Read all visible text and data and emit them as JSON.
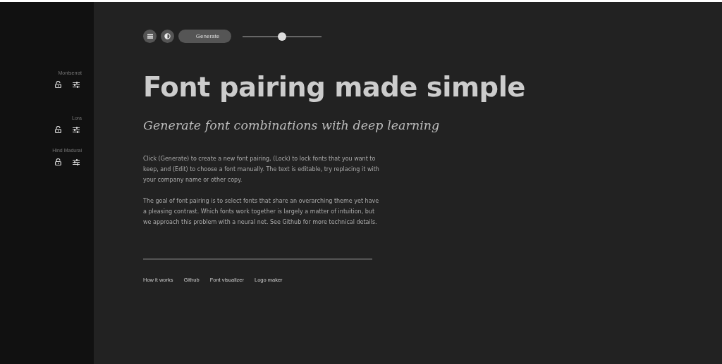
{
  "sidebar": {
    "fonts": [
      {
        "name": "Montserrat"
      },
      {
        "name": "Lora"
      },
      {
        "name": "Hind Madurai"
      }
    ]
  },
  "toolbar": {
    "generate_label": "Generate",
    "slider": {
      "level": 0.5
    }
  },
  "heading": "Font pairing made simple",
  "subheading": "Generate font combinations with deep learning",
  "paragraphs": [
    "Click (Generate) to create a new font pairing, (Lock) to lock fonts that you want to keep, and (Edit) to choose a font manually. The text is editable, try replacing it with your company name or other copy.",
    "The goal of font pairing is to select fonts that share an overarching theme yet have a pleasing contrast. Which fonts work together is largely a matter of intuition, but we approach this problem with a neural net. See Github for more technical details."
  ],
  "footer_links": [
    "How it works",
    "Github",
    "Font visualizer",
    "Logo maker"
  ]
}
